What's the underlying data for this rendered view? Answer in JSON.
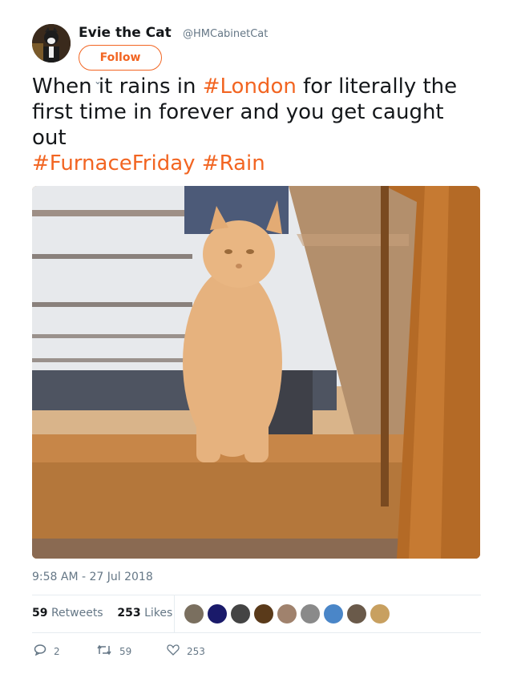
{
  "author": {
    "name": "Evie the Cat",
    "handle": "@HMCabinetCat"
  },
  "follow_label": "Follow",
  "tweet": {
    "part1": "When",
    "part2": " it rains in ",
    "hashtag_london": "#London",
    "part3": " for literally the first time in forever and you get caught out",
    "hashtag_furnace": "#FurnaceFriday",
    "hashtag_rain": "#Rain"
  },
  "media": {
    "icon": "cat-gif"
  },
  "timestamp": "9:58 AM - 27 Jul 2018",
  "stats": {
    "retweets_count": "59",
    "retweets_label": "Retweets",
    "likes_count": "253",
    "likes_label": "Likes"
  },
  "liker_avatars": [
    "#7a6f5f",
    "#1a1a6a",
    "#444444",
    "#5a3a1a",
    "#a0826d",
    "#8a8a8a",
    "#4a86c8",
    "#6a5a4a",
    "#c8a060"
  ],
  "actions": {
    "reply_count": "2",
    "retweet_count": "59",
    "like_count": "253"
  },
  "colors": {
    "accent": "#f26522",
    "muted": "#657786"
  }
}
